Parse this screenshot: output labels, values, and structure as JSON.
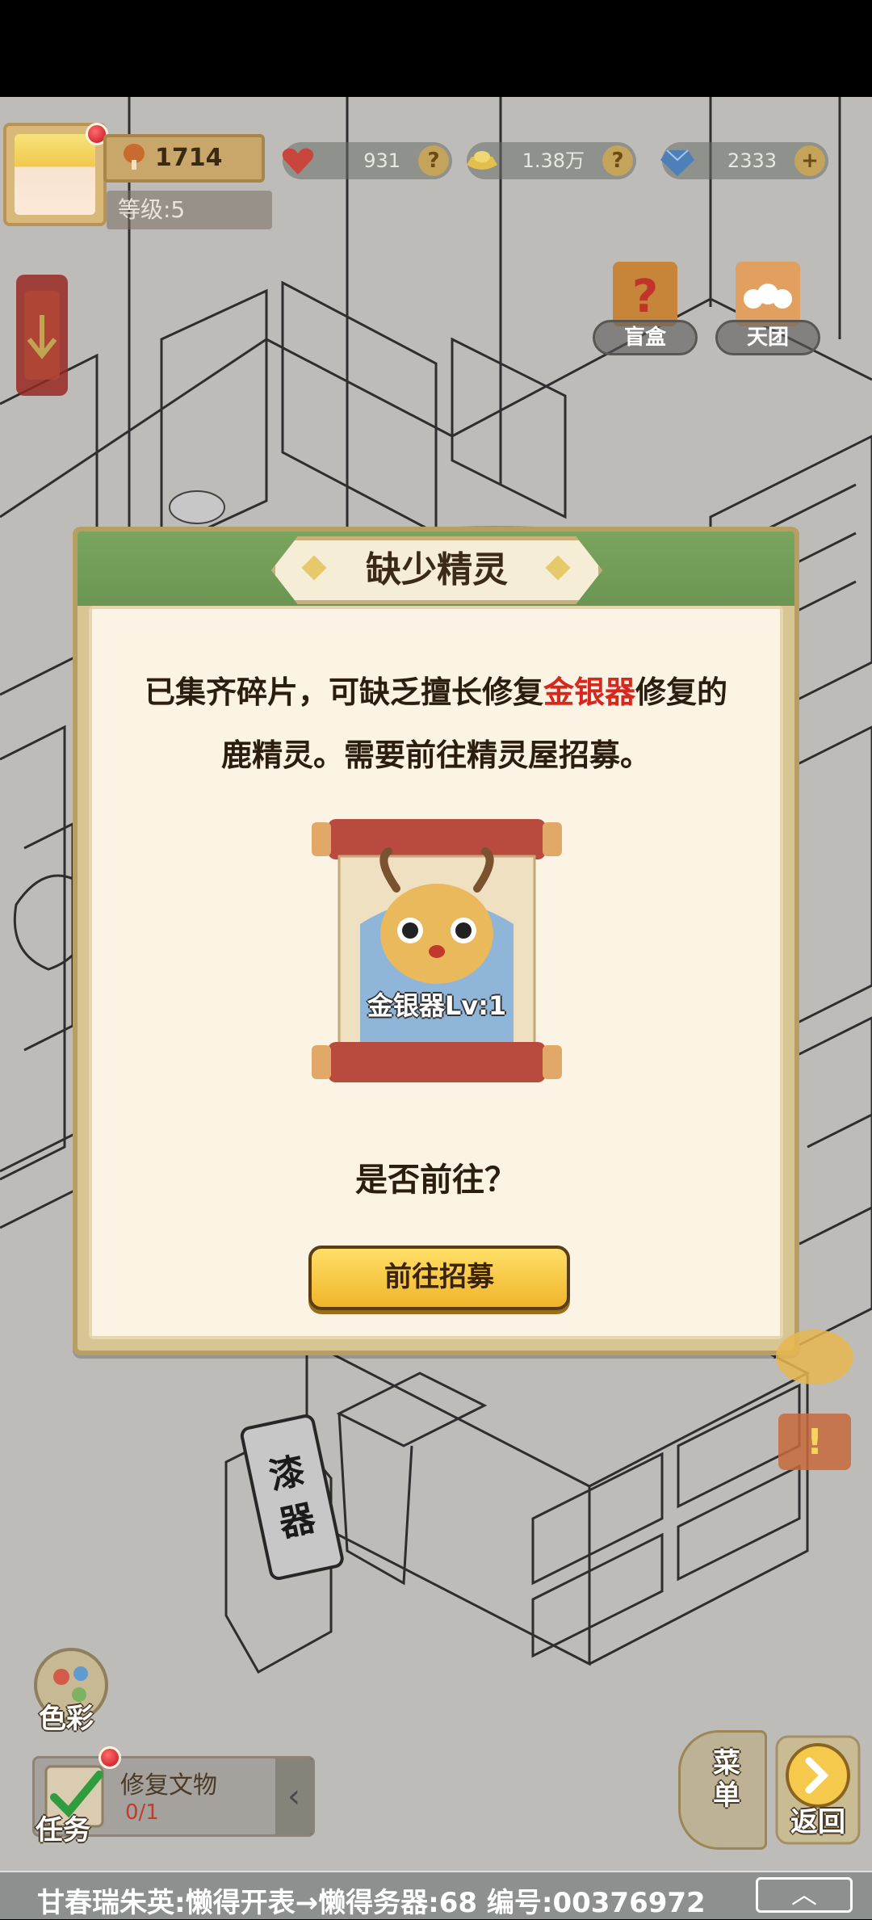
{
  "hud": {
    "currency_value": "1714",
    "level_text": "等级:5",
    "hearts_value": "931",
    "gold_value": "1.38万",
    "gems_value": "2333",
    "plus_symbol": "+",
    "question_symbol": "?",
    "blind_box_label": "盲盒",
    "team_label": "天团"
  },
  "dialog": {
    "title": "缺少精灵",
    "message_part1": "已集齐碎片，可缺乏擅长修复",
    "message_highlight": "金银器",
    "message_part2": "修复的",
    "message_line2": "鹿精灵。需要前往精灵屋招募。",
    "card_label": "金银器Lv:1",
    "question": "是否前往？",
    "confirm_button": "前往招募",
    "highlight_color": "#d6281e"
  },
  "scene": {
    "sign_text": "漆器"
  },
  "bottom": {
    "color_label": "色彩",
    "task_label": "任务",
    "task_title": "修复文物",
    "task_progress": "0/1",
    "task_arrow": "‹",
    "menu_label": "菜单",
    "back_label": "返回",
    "back_arrow": "»"
  },
  "ticker": {
    "name": "甘春瑞朱英:",
    "text": "懒得开表→懒得务器:68   编号:00376972",
    "toggle_symbol": "︿"
  }
}
